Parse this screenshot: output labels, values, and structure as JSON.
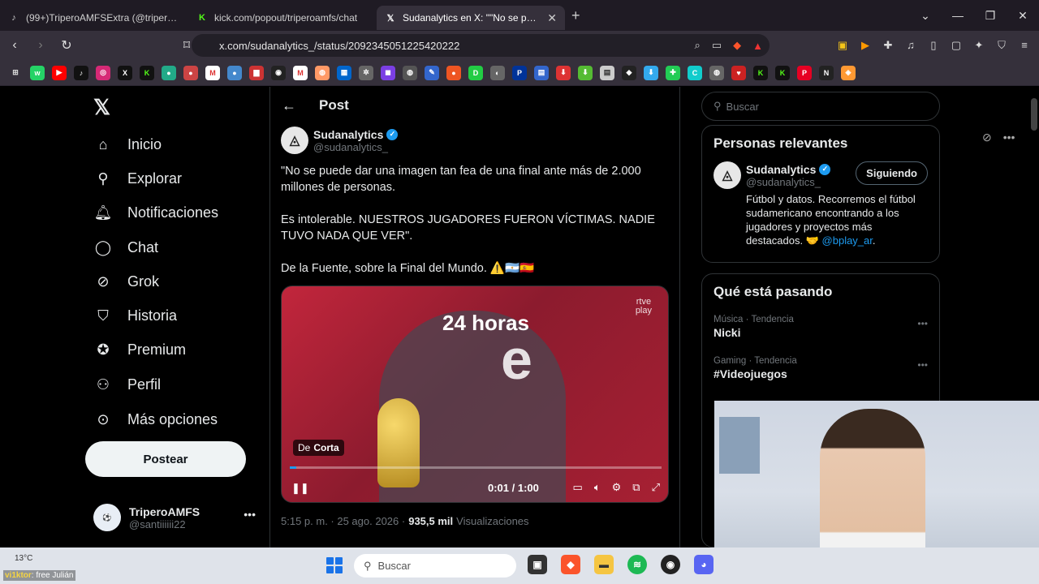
{
  "browser": {
    "tabs": [
      {
        "title": "(99+)TriperoAMFSExtra (@tripero...",
        "icon": "tiktok-icon",
        "color": "#ffffff"
      },
      {
        "title": "kick.com/popout/triperoamfs/chat",
        "icon": "kick-icon",
        "color": "#53fc18"
      },
      {
        "title": "Sudanalytics en X: \"\"No se pue...",
        "icon": "x-icon",
        "color": "#ffffff"
      }
    ],
    "url": "x.com/sudanalytics_/status/2092345051225420222"
  },
  "sidebar": {
    "items": [
      {
        "label": "Inicio",
        "icon": "home-icon"
      },
      {
        "label": "Explorar",
        "icon": "search-icon"
      },
      {
        "label": "Notificaciones",
        "icon": "bell-icon"
      },
      {
        "label": "Chat",
        "icon": "chat-icon"
      },
      {
        "label": "Grok",
        "icon": "grok-icon"
      },
      {
        "label": "Historia",
        "icon": "bookmark-icon"
      },
      {
        "label": "Premium",
        "icon": "verified-icon"
      },
      {
        "label": "Perfil",
        "icon": "person-icon"
      },
      {
        "label": "Más opciones",
        "icon": "more-icon"
      }
    ],
    "post_label": "Postear",
    "account": {
      "name": "TriperoAMFS",
      "handle": "@santiiiiii22"
    }
  },
  "main": {
    "header": "Post",
    "author": {
      "name": "Sudanalytics",
      "handle": "@sudanalytics_"
    },
    "text_lines": [
      "\"No se puede dar una imagen tan fea de una final ante más de 2.000 millones de personas.",
      "Es intolerable. NUESTROS JUGADORES FUERON VÍCTIMAS. NADIE TUVO NADA QUE VER\".",
      "De la Fuente, sobre la Final del Mundo. ⚠️🇦🇷🇪🇸"
    ],
    "video": {
      "badge_prefix": "De",
      "badge_source": "Corta",
      "time": "0:01 / 1:00",
      "progress": 0.017,
      "channel_logo": "24 horas",
      "corner_logo_1": "rtve",
      "corner_logo_2": "play"
    },
    "meta": {
      "time": "5:15 p. m. · 25 ago. 2026 ·",
      "views": "935,5 mil",
      "views_label": "Visualizaciones"
    }
  },
  "right": {
    "search_placeholder": "Buscar",
    "relevant_title": "Personas relevantes",
    "person": {
      "name": "Sudanalytics",
      "handle": "@sudanalytics_",
      "follow_label": "Siguiendo",
      "bio": "Fútbol y datos. Recorremos el fútbol sudamericano encontrando a los jugadores y proyectos más destacados. 🤝",
      "bio_link": "@bplay_ar",
      "bio_end": "."
    },
    "trending_title": "Qué está pasando",
    "trends": [
      {
        "category": "Música · Tendencia",
        "title": "Nicki"
      },
      {
        "category": "Gaming · Tendencia",
        "title": "#Videojuegos"
      }
    ]
  },
  "taskbar": {
    "temperature": "13°C",
    "overlay_user": "vi1ktor",
    "overlay_msg": ": free Julián",
    "search_placeholder": "Buscar"
  }
}
